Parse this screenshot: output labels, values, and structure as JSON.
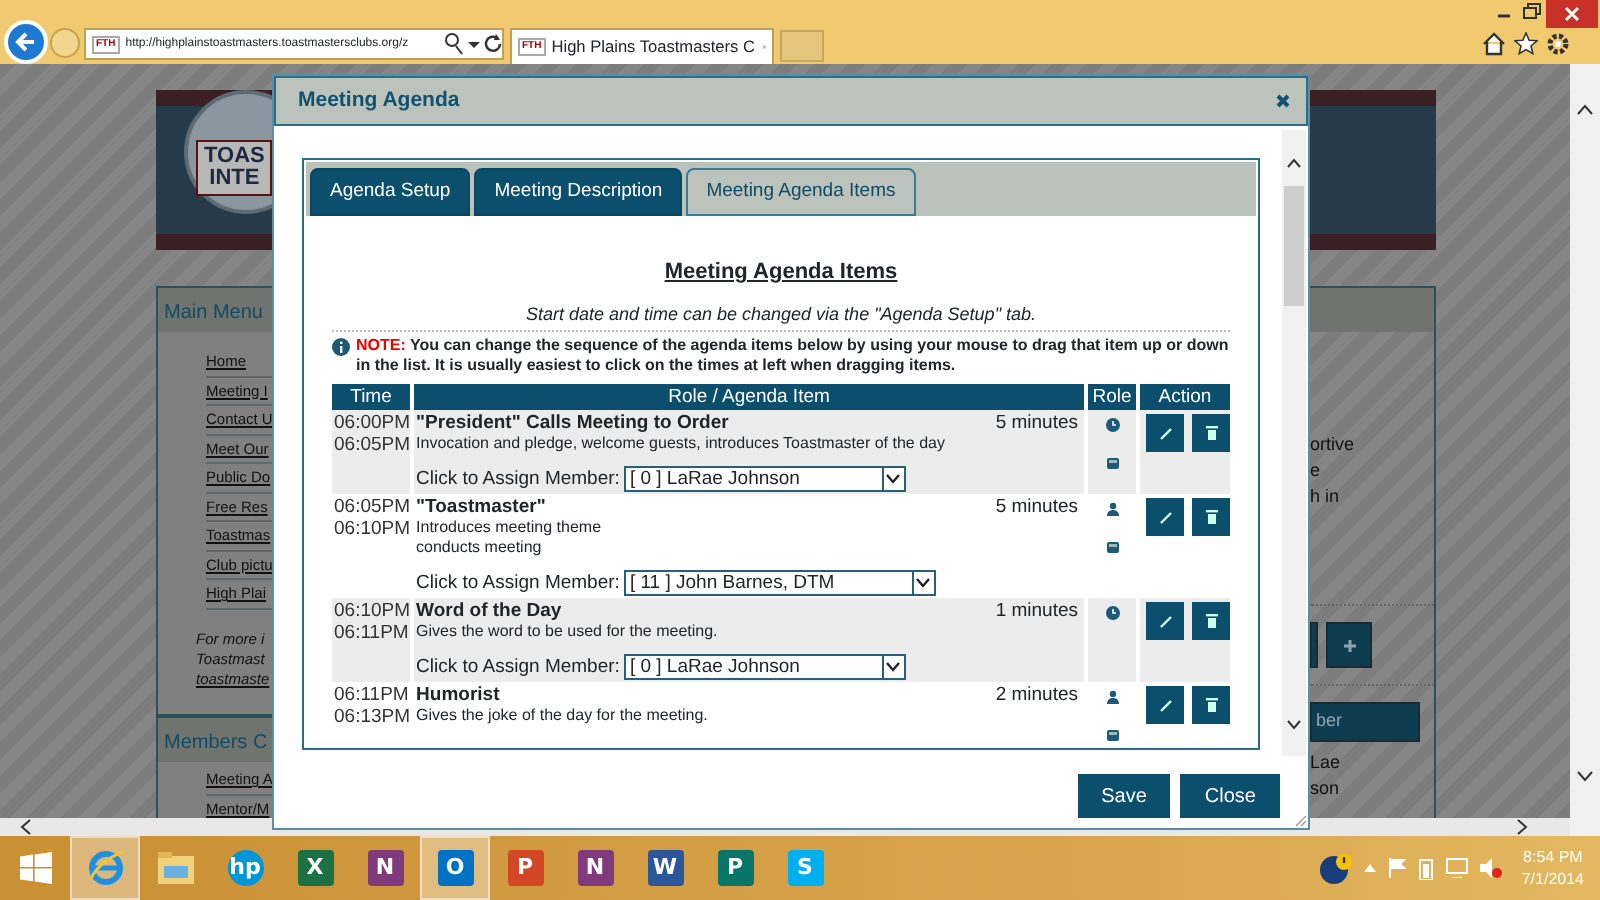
{
  "browser": {
    "address": "http://highplainstoastmasters.toastmastersclubs.org/z",
    "favicon_text": "FTH",
    "tab_favicon_text": "FTH",
    "tab_title": "High Plains Toastmasters C"
  },
  "background_page": {
    "logo_lines": [
      "TOAS",
      "INTE"
    ],
    "main_menu": {
      "title": "Main Menu",
      "links": [
        "Home",
        "Meeting I",
        "Contact U",
        "Meet Our",
        "Public Do",
        "Free Res",
        "Toastmas",
        "Club pictu",
        "High Plai"
      ],
      "note_lines": [
        "For more i",
        "Toastmast",
        "toastmaste"
      ]
    },
    "members_menu": {
      "title": "Members C",
      "links": [
        "Meeting A",
        "Mentor/M"
      ]
    },
    "right_text": [
      "ortive",
      "e",
      "h in"
    ],
    "right_button": "ber",
    "right_lines": [
      "Lae",
      "son"
    ]
  },
  "modal": {
    "title": "Meeting Agenda",
    "tabs": [
      {
        "label": "Agenda Setup",
        "selected": false
      },
      {
        "label": "Meeting Description",
        "selected": false
      },
      {
        "label": "Meeting Agenda Items",
        "selected": true
      }
    ],
    "heading": "Meeting Agenda Items",
    "subtitle": "Start date and time can be changed via the \"Agenda Setup\" tab.",
    "note": {
      "label": "NOTE:",
      "text": "You can change the sequence of the agenda items below by using your mouse to drag that item up or down in the list. It is usually easiest to click on the times at left when dragging items."
    },
    "columns": [
      "Time",
      "Role / Agenda Item",
      "Role",
      "Action"
    ],
    "rows": [
      {
        "start": "06:00PM",
        "end": "06:05PM",
        "title": "\"President\" Calls Meeting to Order",
        "description": [
          "Invocation and pledge, welcome guests, introduces Toastmaster of the day"
        ],
        "duration": "5 minutes",
        "role_icons": [
          {
            "kind": "clock"
          },
          {
            "kind": "book"
          }
        ],
        "assign_label": "Click to Assign Member:",
        "member": "[ 0 ] LaRae Johnson"
      },
      {
        "start": "06:05PM",
        "end": "06:10PM",
        "title": "\"Toastmaster\"",
        "description": [
          "Introduces meeting theme",
          "conducts meeting"
        ],
        "duration": "5 minutes",
        "role_icons": [
          {
            "kind": "person"
          },
          {
            "kind": "book"
          }
        ],
        "assign_label": "Click to Assign Member:",
        "member": "[ 11 ] John Barnes, DTM"
      },
      {
        "start": "06:10PM",
        "end": "06:11PM",
        "title": "Word of the Day",
        "description": [
          "Gives the word to be used for the meeting."
        ],
        "duration": "1 minutes",
        "role_icons": [
          {
            "kind": "clock"
          }
        ],
        "assign_label": "Click to Assign Member:",
        "member": "[ 0 ] LaRae Johnson"
      },
      {
        "start": "06:11PM",
        "end": "06:13PM",
        "title": "Humorist",
        "description": [
          "Gives the joke of the day for the meeting."
        ],
        "duration": "2 minutes",
        "role_icons": [
          {
            "kind": "person"
          },
          {
            "kind": "book"
          }
        ]
      }
    ],
    "buttons": [
      "Save",
      "Close"
    ]
  },
  "taskbar": {
    "apps": [
      {
        "kind": "browser",
        "selected": true
      },
      {
        "kind": "folder",
        "selected": false
      },
      {
        "kind": "letter",
        "letter": "hp",
        "color": "#0096d6",
        "selected": false
      },
      {
        "kind": "letter",
        "letter": "X",
        "color": "#1e7145",
        "selected": false
      },
      {
        "kind": "letter",
        "letter": "N",
        "color": "#80397b",
        "selected": false
      },
      {
        "kind": "letter",
        "letter": "O",
        "color": "#0072c6",
        "selected": true
      },
      {
        "kind": "letter",
        "letter": "P",
        "color": "#d24726",
        "selected": false
      },
      {
        "kind": "letter",
        "letter": "N",
        "color": "#80397b",
        "selected": false
      },
      {
        "kind": "letter",
        "letter": "W",
        "color": "#2b579a",
        "selected": false
      },
      {
        "kind": "letter",
        "letter": "P",
        "color": "#077568",
        "selected": false
      },
      {
        "kind": "letter",
        "letter": "S",
        "color": "#00aff0",
        "selected": false
      }
    ],
    "time": "8:54 PM",
    "date": "7/1/2014"
  }
}
